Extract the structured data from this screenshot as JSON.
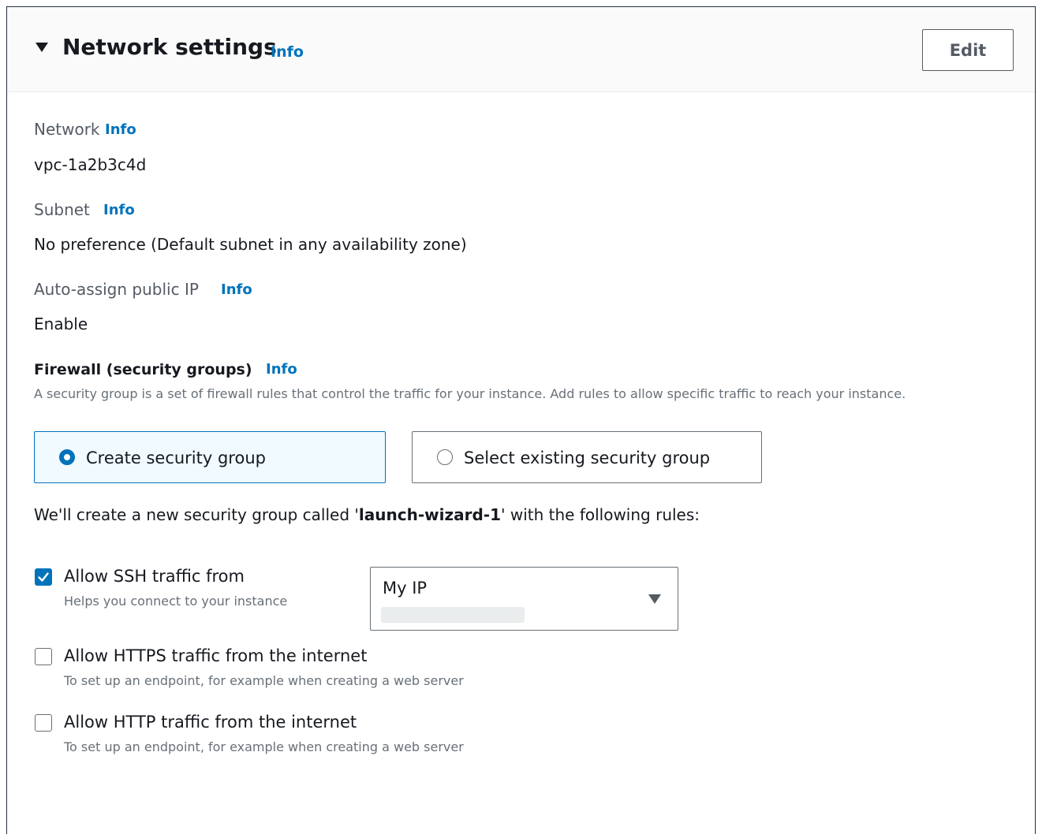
{
  "header": {
    "title": "Network settings",
    "info_link": "Info",
    "edit_label": "Edit"
  },
  "network": {
    "label": "Network",
    "info_link": "Info",
    "value": "vpc-1a2b3c4d"
  },
  "subnet": {
    "label": "Subnet",
    "info_link": "Info",
    "value": "No preference (Default subnet in any availability zone)"
  },
  "public_ip": {
    "label": "Auto-assign public IP",
    "info_link": "Info",
    "value": "Enable"
  },
  "firewall": {
    "label": "Firewall (security groups)",
    "info_link": "Info",
    "description": "A security group is a set of firewall rules that control the traffic for your instance. Add rules to allow specific traffic to reach your instance.",
    "options": [
      {
        "label": "Create security group",
        "selected": true
      },
      {
        "label": "Select existing security group",
        "selected": false
      }
    ],
    "sentence_prefix": "We'll create a new security group called '",
    "group_name": "launch-wizard-1",
    "sentence_suffix": "' with the following rules:"
  },
  "rules": [
    {
      "label": "Allow SSH traffic from",
      "description": "Helps you connect to your instance",
      "checked": true
    },
    {
      "label": "Allow HTTPS traffic from the internet",
      "description": "To set up an endpoint, for example when creating a web server",
      "checked": false
    },
    {
      "label": "Allow HTTP traffic from the internet",
      "description": "To set up an endpoint, for example when creating a web server",
      "checked": false
    }
  ],
  "ssh_source": {
    "value": "My IP"
  },
  "colors": {
    "accent": "#0073bb",
    "text": "#16191f",
    "secondary_text": "#687078",
    "border": "#232f3e"
  },
  "icons": {
    "collapse": "caret-down-icon",
    "check": "checkmark-icon",
    "dropdown": "caret-down-icon"
  }
}
